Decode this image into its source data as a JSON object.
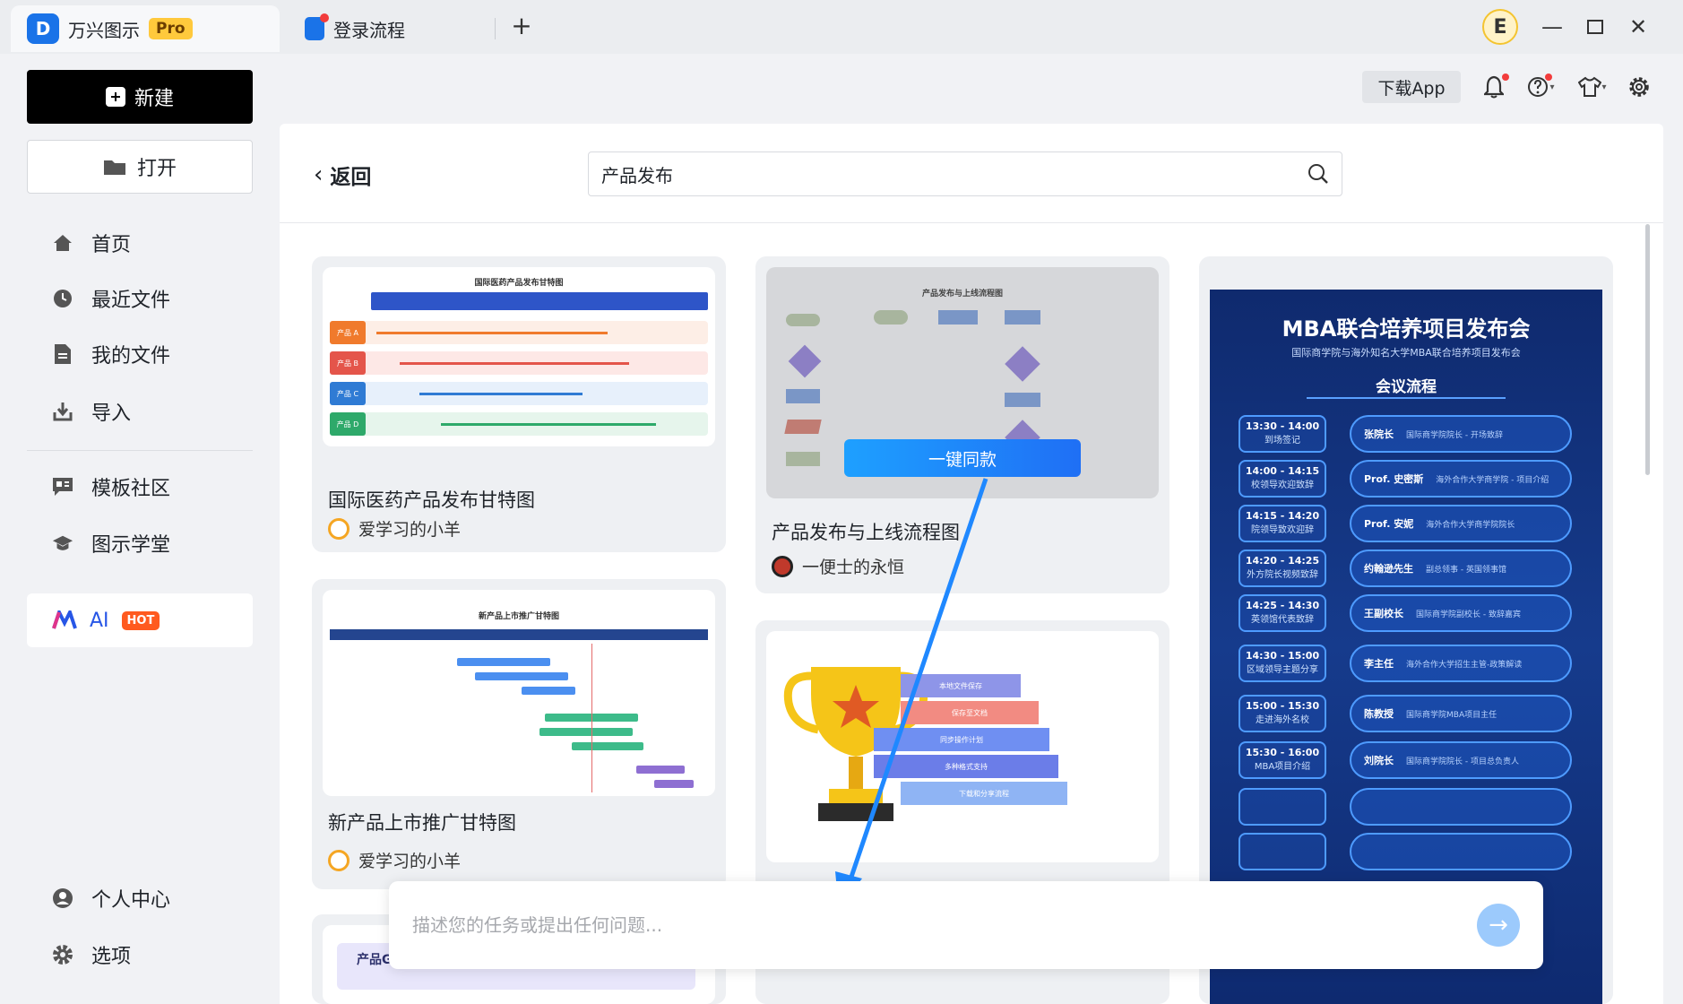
{
  "app": {
    "name": "万兴图示",
    "badge": "Pro"
  },
  "tabs": [
    {
      "label": "万兴图示"
    },
    {
      "label": "登录流程"
    }
  ],
  "user": {
    "avatar_letter": "E"
  },
  "sidebar": {
    "new_label": "新建",
    "open_label": "打开",
    "items": [
      {
        "label": "首页",
        "icon": "home-icon"
      },
      {
        "label": "最近文件",
        "icon": "clock-icon"
      },
      {
        "label": "我的文件",
        "icon": "file-icon"
      },
      {
        "label": "导入",
        "icon": "import-icon"
      },
      {
        "label": "模板社区",
        "icon": "community-icon"
      },
      {
        "label": "图示学堂",
        "icon": "graduation-cap-icon"
      }
    ],
    "ai": {
      "label": "AI",
      "badge": "HOT"
    },
    "bottom": [
      {
        "label": "个人中心",
        "icon": "user-icon"
      },
      {
        "label": "选项",
        "icon": "gear-icon"
      }
    ]
  },
  "header": {
    "download_label": "下载App"
  },
  "main": {
    "back_label": "返回",
    "search_value": "产品发布",
    "cards": [
      {
        "title": "国际医药产品发布甘特图",
        "author": "爱学习的小羊",
        "thumb_title": "国际医药产品发布甘特图"
      },
      {
        "title": "新产品上市推广甘特图",
        "author": "爱学习的小羊",
        "thumb_title": "新产品上市推广甘特图"
      },
      {
        "title": "产品发布与上线流程图",
        "author": "一便士的永恒",
        "thumb_title": "产品发布与上线流程图",
        "clone_label": "一键同款"
      },
      {
        "thumb_caption": "本地文件保存",
        "steps": [
          "本地文件保存",
          "保存至文档",
          "同步操作计划",
          "多种格式支持",
          "下载和分享流程"
        ]
      }
    ],
    "mba": {
      "title": "MBA联合培养项目发布会",
      "subtitle": "国际商学院与海外知名大学MBA联合培养项目发布会",
      "section": "会议流程",
      "rows": [
        {
          "time": "13:30 - 14:00",
          "desc": "到场签记",
          "name": "张院长",
          "role": "国际商学院院长 - 开场致辞"
        },
        {
          "time": "14:00 - 14:15",
          "desc": "校领导欢迎致辞",
          "name": "Prof. 史密斯",
          "role": "海外合作大学商学院 - 项目介绍"
        },
        {
          "time": "14:15 - 14:20",
          "desc": "院领导致欢迎辞",
          "name": "Prof. 安妮",
          "role": "海外合作大学商学院院长"
        },
        {
          "time": "14:20 - 14:25",
          "desc": "外方院长视频致辞",
          "name": "约翰逊先生",
          "role": "副总领事 - 英国领事馆"
        },
        {
          "time": "14:25 - 14:30",
          "desc": "英领馆代表致辞",
          "name": "王副校长",
          "role": "国际商学院副校长 - 致辞嘉宾"
        },
        {
          "time": "14:30 - 15:00",
          "desc": "区域领导主题分享",
          "name": "李主任",
          "role": "海外合作大学招生主管-政策解读"
        },
        {
          "time": "15:00 - 15:30",
          "desc": "走进海外名校",
          "name": "陈教授",
          "role": "国际商学院MBA项目主任"
        },
        {
          "time": "15:30 - 16:00",
          "desc": "MBA项目介绍",
          "name": "刘院长",
          "role": "国际商学院院长 - 项目总负责人"
        }
      ]
    },
    "partial_card_title": "产品Go-To-Market推广方案"
  },
  "ai_prompt": {
    "placeholder": "描述您的任务或提出任何问题..."
  },
  "colors": {
    "brand": "#1a73e8",
    "ai_badge": "#ff5a1f",
    "send_button": "#9ccafc"
  }
}
